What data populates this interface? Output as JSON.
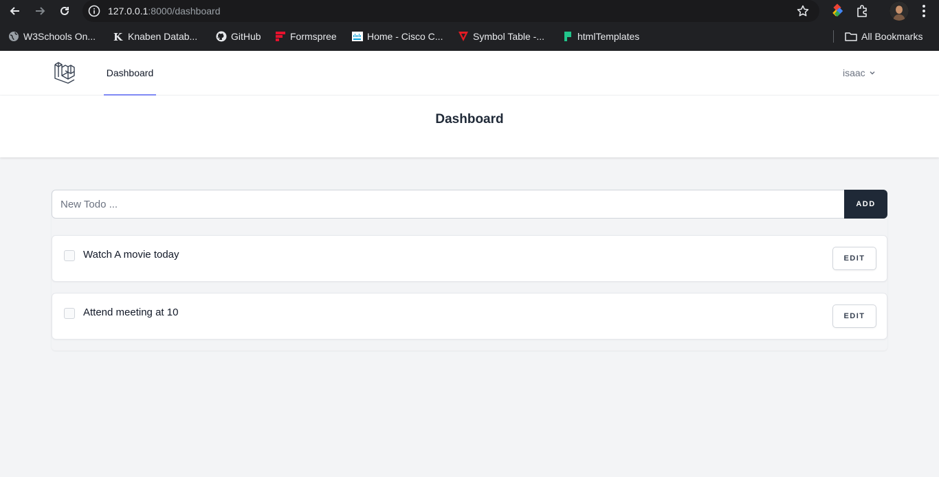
{
  "browser": {
    "url_host": "127.0.0.1",
    "url_path": ":8000/dashboard",
    "bookmarks": [
      {
        "label": "W3Schools On...",
        "icon": "globe-icon"
      },
      {
        "label": "Knaben Datab...",
        "icon": "knaben-icon"
      },
      {
        "label": "GitHub",
        "icon": "github-icon"
      },
      {
        "label": "Formspree",
        "icon": "formspree-icon"
      },
      {
        "label": "Home - Cisco C...",
        "icon": "cisco-icon"
      },
      {
        "label": "Symbol Table -...",
        "icon": "symbol-table-icon"
      },
      {
        "label": "htmlTemplates",
        "icon": "html-templates-icon"
      }
    ],
    "all_bookmarks": "All Bookmarks"
  },
  "nav": {
    "links": [
      {
        "label": "Dashboard",
        "active": true
      }
    ],
    "user": "isaac"
  },
  "header": {
    "title": "Dashboard"
  },
  "todo_form": {
    "placeholder": "New Todo ...",
    "add_label": "ADD"
  },
  "todos": [
    {
      "text": "Watch A movie today",
      "done": false,
      "edit_label": "EDIT"
    },
    {
      "text": "Attend meeting at 10",
      "done": false,
      "edit_label": "EDIT"
    }
  ],
  "colors": {
    "accent": "#818cf8",
    "dark_button": "#1f2937",
    "page_bg": "#f3f4f6"
  }
}
